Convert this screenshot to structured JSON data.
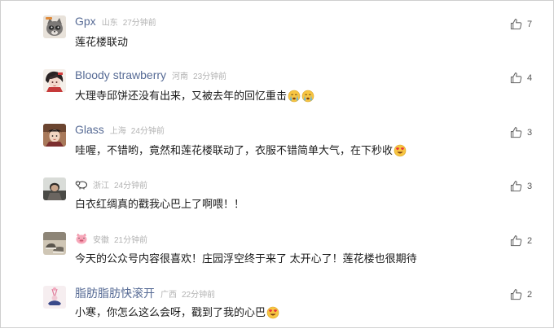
{
  "comments": [
    {
      "nickname": "Gpx",
      "location": "山东",
      "time": "27分钟前",
      "text": "莲花楼联动",
      "likes": "7",
      "avatar_icon": "gray-raccoon-cat-avatar",
      "emojis": []
    },
    {
      "nickname": "Bloody strawberry",
      "location": "河南",
      "time": "23分钟前",
      "text": "大理寺邱饼还没有出来，又被去年的回忆重击",
      "likes": "4",
      "avatar_icon": "anime-character-avatar",
      "emojis": [
        "crying-face-emoji",
        "crying-face-emoji"
      ]
    },
    {
      "nickname": "Glass",
      "location": "上海",
      "time": "24分钟前",
      "text": "哇喔，不错哟，竟然和莲花楼联动了，衣服不错简单大气，在下秒收",
      "likes": "3",
      "avatar_icon": "drama-character-avatar",
      "emojis": [
        "heart-eyes-emoji"
      ]
    },
    {
      "nickname": "",
      "location": "浙江",
      "time": "24分钟前",
      "text": "白衣红绸真的戳我心巴上了啊喂！！",
      "likes": "3",
      "avatar_icon": "person-photo-avatar",
      "flag_icon": "sheep-sticker-icon",
      "emojis": []
    },
    {
      "nickname": "",
      "location": "安徽",
      "time": "21分钟前",
      "text": "今天的公众号内容很喜欢！庄园浮空终于来了 太开心了！莲花楼也很期待",
      "likes": "2",
      "avatar_icon": "shoes-photo-avatar",
      "flag_icon": "pig-face-icon",
      "emojis": []
    },
    {
      "nickname": "脂肪脂肪快滚开",
      "location": "广西",
      "time": "22分钟前",
      "text": "小寒，你怎么这么会呀，戳到了我的心巴",
      "likes": "2",
      "avatar_icon": "pink-illustration-avatar",
      "emojis": [
        "heart-eyes-emoji"
      ]
    }
  ],
  "colors": {
    "nickname": "#576b95",
    "meta": "#b2b2b2",
    "text": "#1a1a1a"
  },
  "like_icon": "thumbs-up-icon"
}
